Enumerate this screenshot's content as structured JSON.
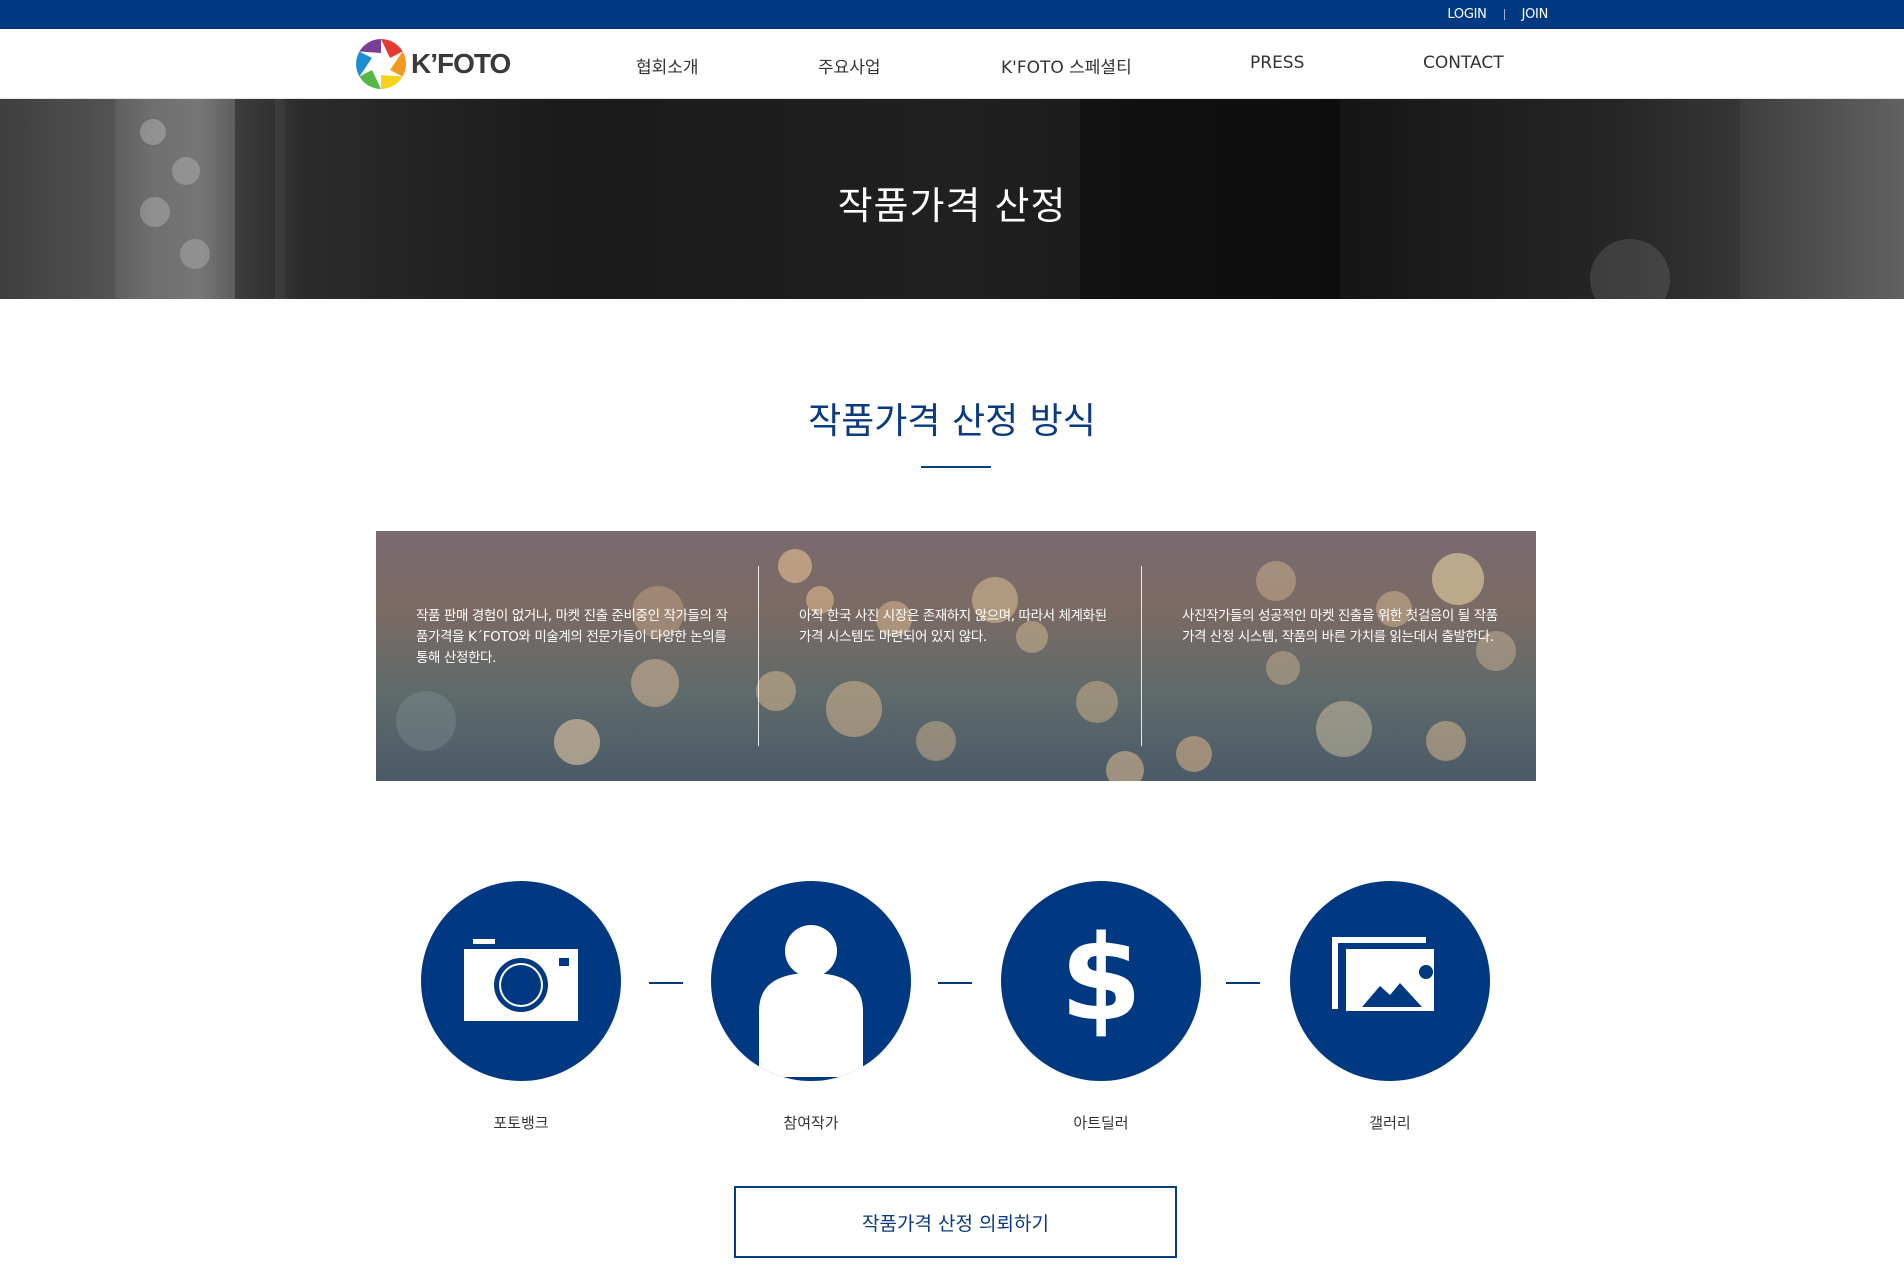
{
  "topbar": {
    "login": "LOGIN",
    "join": "JOIN"
  },
  "header": {
    "logo_text": "K’FOTO",
    "nav": [
      "협회소개",
      "주요사업",
      "K'FOTO 스페셜티",
      "PRESS",
      "CONTACT"
    ]
  },
  "hero": {
    "title": "작품가격 산정"
  },
  "section": {
    "title": "작품가격 산정 방식",
    "columns": [
      "작품 판매 경험이 없거나, 마켓 진출 준비중인 작가들의 작품가격을 K´FOTO와 미술계의 전문가들이 다양한 논의를 통해 산정한다.",
      "아직 한국 사진 시장은 존재하지 않으며, 따라서 체계화된 가격 시스템도 마련되어 있지 않다.",
      "사진작가들의 성공적인 마켓 진출을 위한 첫걸음이 될 작품가격 산정 시스템, 작품의 바른 가치를 읽는데서 출발한다."
    ]
  },
  "steps": [
    {
      "label": "포토뱅크",
      "icon": "camera-icon"
    },
    {
      "label": "참여작가",
      "icon": "person-icon"
    },
    {
      "label": "아트딜러",
      "icon": "dollar-icon"
    },
    {
      "label": "갤러리",
      "icon": "gallery-image-icon"
    }
  ],
  "cta": {
    "label": "작품가격 산정 의뢰하기"
  },
  "colors": {
    "brand_navy": "#003882",
    "title_blue": "#0a3a82"
  }
}
